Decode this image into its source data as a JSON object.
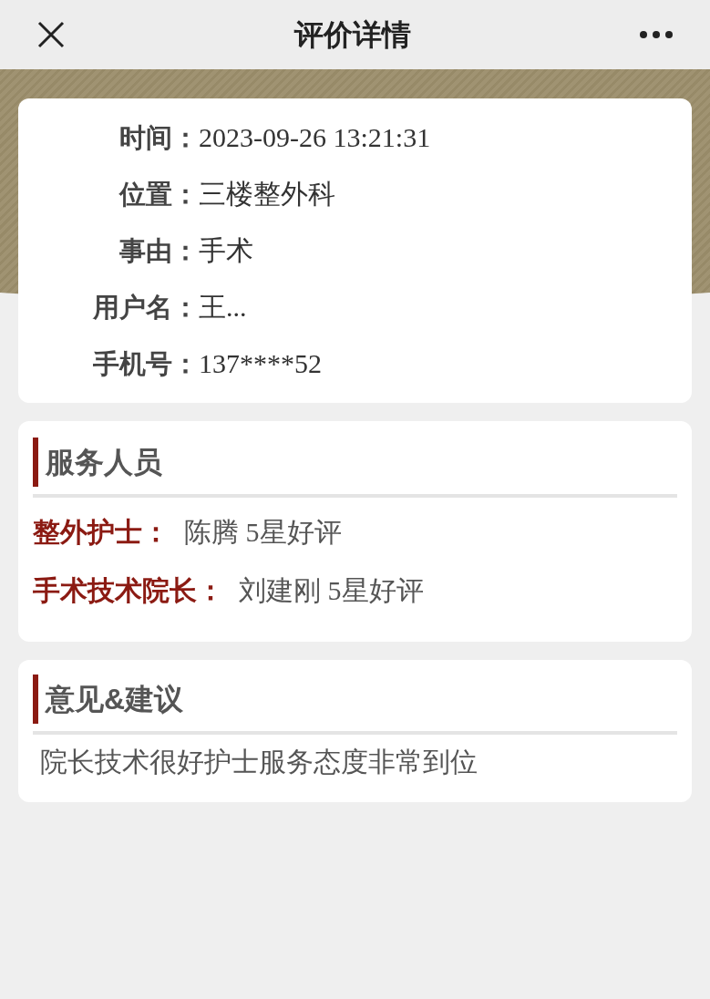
{
  "nav": {
    "title": "评价详情"
  },
  "info": [
    {
      "label": "时间：",
      "value": "2023-09-26 13:21:31"
    },
    {
      "label": "位置：",
      "value": "三楼整外科"
    },
    {
      "label": "事由：",
      "value": "手术"
    },
    {
      "label": "用户名：",
      "value": "王..."
    },
    {
      "label": "手机号：",
      "value": "137****52"
    }
  ],
  "staff": {
    "title": "服务人员",
    "rows": [
      {
        "role": "整外护士：",
        "value": "陈腾 5星好评"
      },
      {
        "role": "手术技术院长：",
        "value": "刘建刚 5星好评"
      }
    ]
  },
  "feedback": {
    "title": "意见&建议",
    "text": "院长技术很好护士服务态度非常到位"
  }
}
